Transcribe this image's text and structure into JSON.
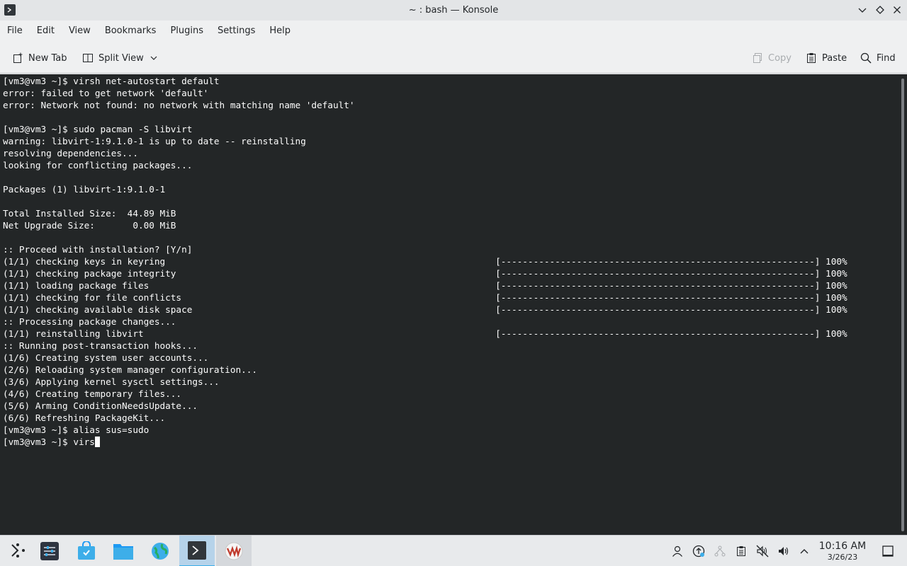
{
  "window": {
    "title": "~ : bash — Konsole",
    "icon": "konsole-icon"
  },
  "menubar": {
    "items": [
      "File",
      "Edit",
      "View",
      "Bookmarks",
      "Plugins",
      "Settings",
      "Help"
    ]
  },
  "toolbar": {
    "new_tab": "New Tab",
    "split_view": "Split View",
    "copy": "Copy",
    "paste": "Paste",
    "find": "Find"
  },
  "terminal": {
    "background": "#232627",
    "foreground": "#fcfcfc",
    "lines": [
      "[vm3@vm3 ~]$ virsh net-autostart default",
      "error: failed to get network 'default'",
      "error: Network not found: no network with matching name 'default'",
      "",
      "[vm3@vm3 ~]$ sudo pacman -S libvirt",
      "warning: libvirt-1:9.1.0-1 is up to date -- reinstalling",
      "resolving dependencies...",
      "looking for conflicting packages...",
      "",
      "Packages (1) libvirt-1:9.1.0-1",
      "",
      "Total Installed Size:  44.89 MiB",
      "Net Upgrade Size:       0.00 MiB",
      "",
      ":: Proceed with installation? [Y/n]",
      "(1/1) checking keys in keyring                                                             [----------------------------------------------------------] 100%",
      "(1/1) checking package integrity                                                           [----------------------------------------------------------] 100%",
      "(1/1) loading package files                                                                [----------------------------------------------------------] 100%",
      "(1/1) checking for file conflicts                                                          [----------------------------------------------------------] 100%",
      "(1/1) checking available disk space                                                        [----------------------------------------------------------] 100%",
      ":: Processing package changes...",
      "(1/1) reinstalling libvirt                                                                 [----------------------------------------------------------] 100%",
      ":: Running post-transaction hooks...",
      "(1/6) Creating system user accounts...",
      "(2/6) Reloading system manager configuration...",
      "(3/6) Applying kernel sysctl settings...",
      "(4/6) Creating temporary files...",
      "(5/6) Arming ConditionNeedsUpdate...",
      "(6/6) Refreshing PackageKit...",
      "[vm3@vm3 ~]$ alias sus=sudo"
    ],
    "prompt": "[vm3@vm3 ~]$ ",
    "current_input": "virs"
  },
  "taskbar": {
    "apps": [
      "application-launcher-icon",
      "system-settings-icon",
      "discover-store-icon",
      "file-manager-icon",
      "web-browser-icon",
      "konsole-icon",
      "virt-manager-icon"
    ],
    "tray": [
      "user-icon",
      "updates-icon",
      "network-icon",
      "clipboard-icon",
      "audio-muted-icon",
      "volume-icon",
      "expand-tray-icon"
    ],
    "time": "10:16 AM",
    "date": "3/26/23",
    "show_desktop": "show-desktop-icon"
  }
}
